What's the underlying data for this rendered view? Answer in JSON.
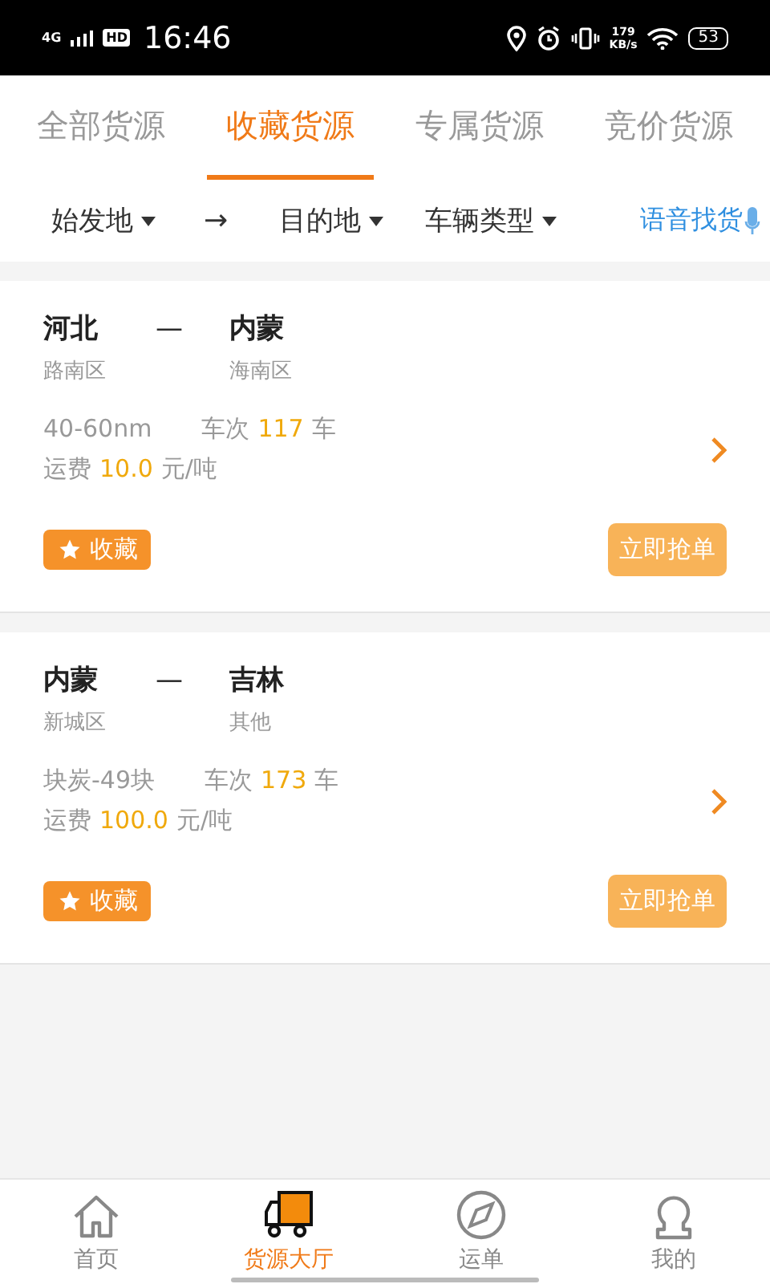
{
  "status_bar": {
    "network": "4G",
    "hd": "HD",
    "time": "16:46",
    "speed": "179",
    "speed_unit": "KB/s",
    "battery": "53"
  },
  "tabs": [
    {
      "label": "全部货源",
      "selected": false
    },
    {
      "label": "收藏货源",
      "selected": true
    },
    {
      "label": "专属货源",
      "selected": false
    },
    {
      "label": "竞价货源",
      "selected": false
    }
  ],
  "filters": {
    "origin": "始发地",
    "arrow": "→",
    "destination": "目的地",
    "vehicle_type": "车辆类型",
    "voice_search": "语音找货"
  },
  "cargo": [
    {
      "from": "河北",
      "from_district": "路南区",
      "dash": "—",
      "to": "内蒙",
      "to_district": "海南区",
      "spec": "40-60nm",
      "trips_label": "车次",
      "trips": "117",
      "trips_unit": "车",
      "fee_label": "运费",
      "fee": "10.0",
      "fee_unit": "元/吨",
      "favorite": "收藏",
      "grab": "立即抢单"
    },
    {
      "from": "内蒙",
      "from_district": "新城区",
      "dash": "—",
      "to": "吉林",
      "to_district": "其他",
      "spec": "块炭-49块",
      "trips_label": "车次",
      "trips": "173",
      "trips_unit": "车",
      "fee_label": "运费",
      "fee": "100.0",
      "fee_unit": "元/吨",
      "favorite": "收藏",
      "grab": "立即抢单"
    }
  ],
  "bottom_nav": [
    {
      "label": "首页",
      "kind": "home",
      "selected": false
    },
    {
      "label": "货源大厅",
      "kind": "truck",
      "selected": true
    },
    {
      "label": "运单",
      "kind": "compass",
      "selected": false
    },
    {
      "label": "我的",
      "kind": "person",
      "selected": false
    }
  ]
}
